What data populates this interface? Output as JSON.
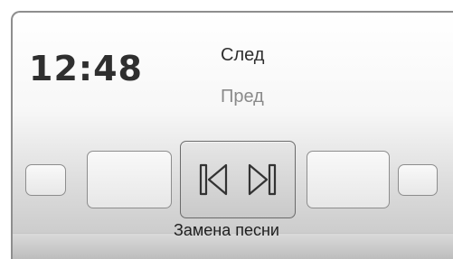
{
  "clock": {
    "time": "12:48"
  },
  "menu": {
    "next_label": "След",
    "prev_label": "Пред"
  },
  "carousel": {
    "tiles": [
      "tile-far-left",
      "tile-left",
      "tile-center",
      "tile-right",
      "tile-far-right"
    ],
    "center_icons": [
      "skip-back-icon",
      "skip-forward-icon"
    ]
  },
  "footer": {
    "caption": "Замена песни"
  }
}
